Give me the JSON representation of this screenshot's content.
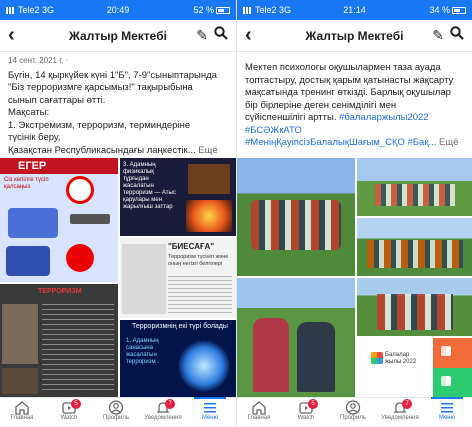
{
  "left": {
    "status": {
      "carrier": "Tele2  3G",
      "time": "20:49",
      "battery": "52 %"
    },
    "nav": {
      "title": "Жалтыр Мектебі"
    },
    "post": {
      "meta": "14 сент. 2021 г. ·",
      "lines": [
        "Бүгін, 14 қыркүйек күні 1\"Б\", 7-9\"сыныптарында",
        "\"Біз терроризмге қарсымыз!\" тақырыбына",
        "сынып сағаттары өтті.",
        "Мақсаты:",
        "1. Экстремизм, терроризм, терминдеріне",
        "түсінік беру,"
      ],
      "last_line": "Қазақстан Республикасындағы лаңкестік...",
      "more": "Ещё"
    },
    "images": {
      "poster_title": "ЕГЕР",
      "poster_subtitle": "Сіз кепілге түсіп қалсаңыз",
      "info_text": "3. Адамның физикалық тұрғыдан жасалатын терроризм — Атыс қарулары мен жарылғыш заттар",
      "terror_label": "ТЕРРОРИЗМ",
      "paper_title": "\"БИЕСАҒА\"",
      "paper_sub": "Терроризм түсінігі және оның негізгі белгілері",
      "blue_title": "Терроризмнің екі түрі болады",
      "blue_point": "1. Адамның санасына жасалатын терроризм ."
    },
    "tabs": [
      {
        "label": "Главная",
        "icon": "home-icon"
      },
      {
        "label": "Watch",
        "icon": "watch-icon",
        "badge": "5"
      },
      {
        "label": "Профиль",
        "icon": "profile-icon"
      },
      {
        "label": "Уведомления",
        "icon": "bell-icon",
        "badge": "7"
      },
      {
        "label": "Меню",
        "icon": "menu-icon"
      }
    ]
  },
  "right": {
    "status": {
      "carrier": "Tele2  3G",
      "time": "21:14",
      "battery": "34 %"
    },
    "nav": {
      "title": "Жалтыр Мектебі"
    },
    "post": {
      "lines": [
        "Мектеп психологы оқушылармен таза ауада",
        "топтастыру, достық қарым қатынасты жақсарту",
        "мақсатында тренинг өткізді. Барлық оқушылар",
        "бір бірлеріне деген сенімділігі мен",
        "сүйіспеншілігі артты."
      ],
      "hashtag1": "#балаларжылы2022",
      "hashtag2": "#БСӘЖкАТО",
      "hashtag3": "#МеніңҚауіпсізБалалықШағым_СҚО #Бақ...",
      "more": "Ещё"
    },
    "images": {
      "logo_text": "Балалар жылы 2022"
    },
    "tabs": [
      {
        "label": "Главная",
        "icon": "home-icon"
      },
      {
        "label": "Watch",
        "icon": "watch-icon",
        "badge": "5"
      },
      {
        "label": "Профиль",
        "icon": "profile-icon"
      },
      {
        "label": "Уведомления",
        "icon": "bell-icon",
        "badge": "7"
      },
      {
        "label": "Меню",
        "icon": "menu-icon"
      }
    ]
  },
  "colors": {
    "brand": "#1877f2",
    "badge": "#e41e3f",
    "hashtag": "#216fdb"
  }
}
